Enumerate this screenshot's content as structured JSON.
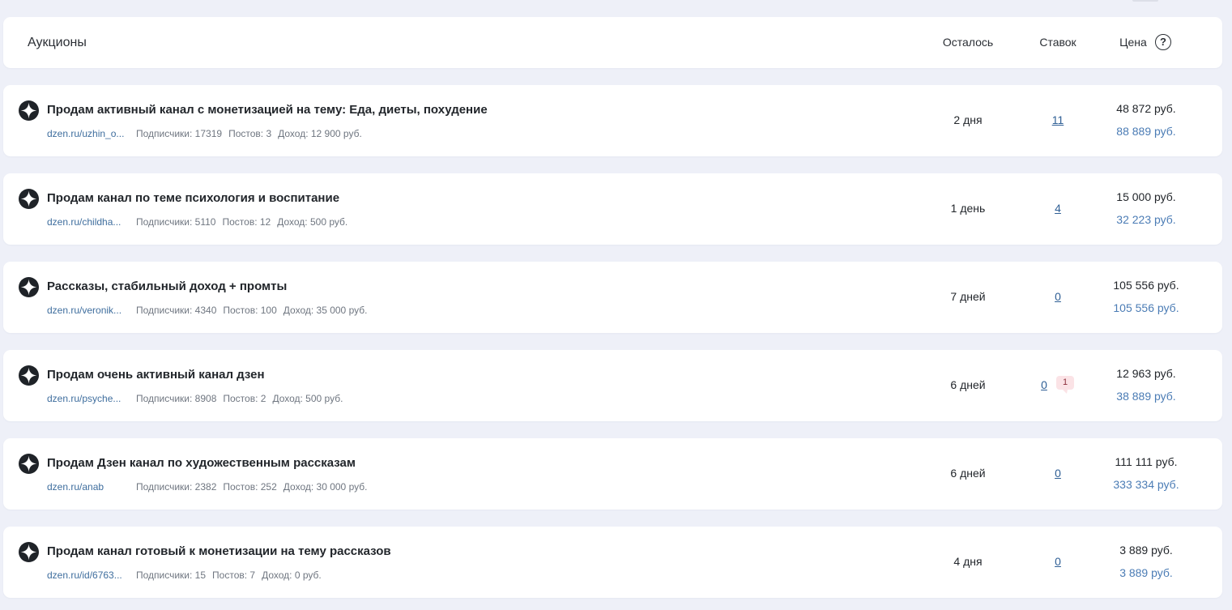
{
  "header": {
    "title": "Аукционы",
    "col_remaining": "Осталось",
    "col_bids": "Ставок",
    "col_price": "Цена",
    "help": "?"
  },
  "colors": {
    "background": "#eef0f8",
    "card": "#ffffff",
    "link": "#2f5f95",
    "buyout": "#4b7cb5",
    "badge_bg": "#fbe3e6"
  },
  "logo_icon": "dzen-star-icon",
  "auctions": [
    {
      "name": "Продам активный канал с монетизацией на тему: Еда, диеты, похудение",
      "url": "dzen.ru/uzhin_o...",
      "subscribers": "Подписчики: 17319",
      "posts": "Постов: 3",
      "income": "Доход: 12 900 руб.",
      "remaining": "2 дня",
      "bids": "11",
      "price": "48 872 руб.",
      "buyout": "88 889 руб."
    },
    {
      "name": "Продам канал по теме психология и воспитание",
      "url": "dzen.ru/childha...",
      "subscribers": "Подписчики: 5110",
      "posts": "Постов: 12",
      "income": "Доход: 500 руб.",
      "remaining": "1 день",
      "bids": "4",
      "price": "15 000 руб.",
      "buyout": "32 223 руб."
    },
    {
      "name": "Рассказы, стабильный доход + промты",
      "url": "dzen.ru/veronik...",
      "subscribers": "Подписчики: 4340",
      "posts": "Постов: 100",
      "income": "Доход: 35 000 руб.",
      "remaining": "7 дней",
      "bids": "0",
      "price": "105 556 руб.",
      "buyout": "105 556 руб."
    },
    {
      "name": "Продам очень активный канал дзен",
      "url": "dzen.ru/psyche...",
      "subscribers": "Подписчики: 8908",
      "posts": "Постов: 2",
      "income": "Доход: 500 руб.",
      "remaining": "6 дней",
      "bids": "0",
      "comments": "1",
      "price": "12 963 руб.",
      "buyout": "38 889 руб."
    },
    {
      "name": "Продам Дзен канал по художественным рассказам",
      "url": "dzen.ru/anab",
      "subscribers": "Подписчики: 2382",
      "posts": "Постов: 252",
      "income": "Доход: 30 000 руб.",
      "remaining": "6 дней",
      "bids": "0",
      "price": "111 111 руб.",
      "buyout": "333 334 руб."
    },
    {
      "name": "Продам канал готовый к монетизации на тему рассказов",
      "url": "dzen.ru/id/6763...",
      "subscribers": "Подписчики: 15",
      "posts": "Постов: 7",
      "income": "Доход: 0 руб.",
      "remaining": "4 дня",
      "bids": "0",
      "price": "3 889 руб.",
      "buyout": "3 889 руб."
    }
  ]
}
